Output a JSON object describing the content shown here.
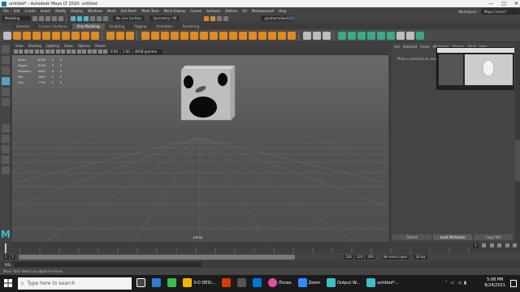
{
  "window": {
    "title": "untitled* - Autodesk Maya LT 2020: untitled",
    "controls": [
      "—",
      "□",
      "✕"
    ]
  },
  "menubar": {
    "items": [
      "File",
      "Edit",
      "Create",
      "Select",
      "Modify",
      "Display",
      "Windows",
      "Mesh",
      "Edit Mesh",
      "Mesh Tools",
      "Mesh Display",
      "Curves",
      "Surfaces",
      "Deform",
      "UV",
      "MarketplaceA",
      "Help"
    ],
    "workspace_label": "Workspace :",
    "workspace_value": "Maya Classic*"
  },
  "statusline": {
    "mode": "Modeling",
    "live_surface": "No Live Surface",
    "symmetry": "Symmetry: Off",
    "account": "yourhomeless123"
  },
  "shelf": {
    "tabs": [
      "General",
      "Curves / Surfaces",
      "Poly Modeling",
      "Sculpting",
      "Rigging",
      "Animation",
      "Rendering"
    ],
    "active": "Poly Modeling"
  },
  "viewport": {
    "menu": [
      "View",
      "Shading",
      "Lighting",
      "Show",
      "Options",
      "Panels"
    ],
    "near_clip": "0.00",
    "far_clip": "1.00",
    "color_space": "sRGB gamma",
    "camera_label": "persp",
    "hud": [
      {
        "label": "Verts:",
        "v1": "8136",
        "v2": "0",
        "v3": "0"
      },
      {
        "label": "Edges:",
        "v1": "8136",
        "v2": "0",
        "v3": "0"
      },
      {
        "label": "Polygons:",
        "v1": "4000",
        "v2": "0",
        "v3": "0"
      },
      {
        "label": "Tris:",
        "v1": "4000",
        "v2": "0",
        "v3": "0"
      },
      {
        "label": "UVs:",
        "v1": "7776",
        "v2": "0",
        "v3": "0"
      }
    ]
  },
  "attribute_editor": {
    "tabs": [
      "List",
      "Selected",
      "Focus",
      "Attributes",
      "Display",
      "Show",
      "Help"
    ],
    "message": "Make a selection to view attributes",
    "buttons": [
      "Select",
      "Load Attributes",
      "Copy Tab"
    ],
    "side_tab": "Attribute Editor"
  },
  "timeline": {
    "ticks": [
      "5",
      "10",
      "15",
      "20",
      "25",
      "30",
      "35",
      "40",
      "45",
      "50",
      "55",
      "60",
      "65",
      "70",
      "75",
      "80",
      "85",
      "90",
      "95",
      "100",
      "105",
      "110",
      "115",
      "120"
    ],
    "current_frame": "1",
    "range_start": "1",
    "range_start_inner": "1",
    "range_end_inner": "120",
    "range_end": "120",
    "range_min": "200",
    "anim_layer": "No Anim Layer",
    "fps": "24 fps"
  },
  "cmdline": {
    "label": "MEL"
  },
  "helpline": {
    "text": "Move Tool: Select an object to move."
  },
  "taskbar": {
    "search_placeholder": "Type here to search",
    "apps": [
      {
        "name": "3-D DESI...",
        "color": "#f7b500"
      },
      {
        "name": "iTunes",
        "color": "#e64ba6"
      },
      {
        "name": "Zoom",
        "color": "#2d8cff"
      },
      {
        "name": "Output W...",
        "color": "#3bc0c8"
      },
      {
        "name": "untitled*...",
        "color": "#3bc0c8"
      }
    ],
    "time": "5:08 PM",
    "date": "6/24/2021"
  },
  "colors": {
    "maya_cyan": "#3bc0c8",
    "shelf_orange": "#e08a22",
    "shelf_green": "#3aa88a",
    "taskbar": "#1b1b1b"
  }
}
